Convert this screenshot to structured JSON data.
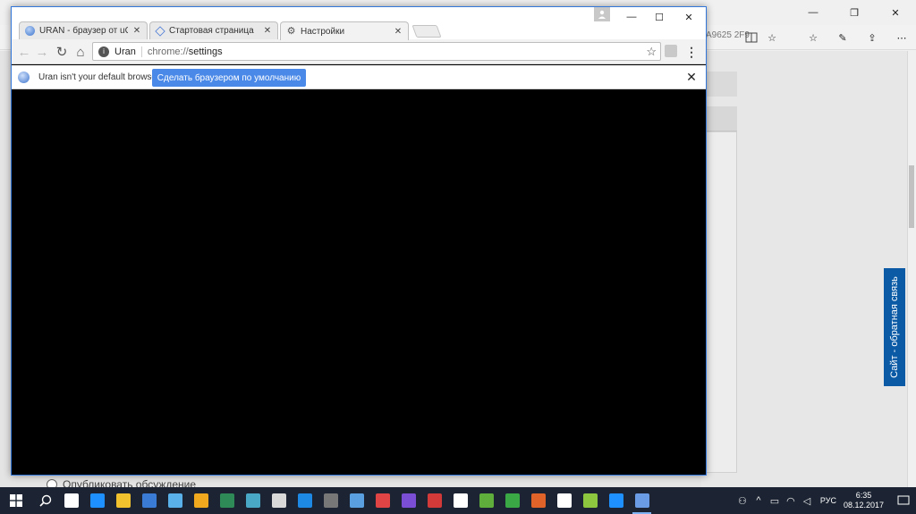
{
  "edge": {
    "url_tail": "A9625 2F9",
    "feedback_label": "Сайт - обратная связь",
    "comment_label": "Опубликовать обсуждение"
  },
  "uran": {
    "tabs": [
      {
        "title": "URAN - браузер от uCoz",
        "favicon": "globe-icon"
      },
      {
        "title": "Стартовая страница",
        "favicon": "diamond-icon"
      },
      {
        "title": "Настройки",
        "favicon": "gear-icon"
      }
    ],
    "omnibox": {
      "site_name": "Uran",
      "url_scheme": "chrome://",
      "url_path": "settings"
    },
    "infobar": {
      "message": "Uran isn't your default browser.",
      "button_label": "Сделать браузером по умолчанию"
    }
  },
  "taskbar": {
    "apps": [
      {
        "name": "task-view",
        "color": "#ffffff",
        "running": false
      },
      {
        "name": "edge",
        "color": "#1e90ff",
        "running": false
      },
      {
        "name": "explorer",
        "color": "#f2c12e",
        "running": false
      },
      {
        "name": "store",
        "color": "#3a7bd5",
        "running": false
      },
      {
        "name": "mail",
        "color": "#5ab0e8",
        "running": false
      },
      {
        "name": "photos",
        "color": "#f0a81e",
        "running": false
      },
      {
        "name": "app-green",
        "color": "#2e8b57",
        "running": false
      },
      {
        "name": "app-teal",
        "color": "#4aa8c7",
        "running": false
      },
      {
        "name": "calculator",
        "color": "#d9d9d9",
        "running": false
      },
      {
        "name": "app-blue",
        "color": "#1e88e5",
        "running": false
      },
      {
        "name": "app-gray",
        "color": "#777777",
        "running": false
      },
      {
        "name": "app-dots",
        "color": "#5aa0e0",
        "running": false
      },
      {
        "name": "app-paint",
        "color": "#e04444",
        "running": false
      },
      {
        "name": "visual-studio",
        "color": "#7b4ed6",
        "running": false
      },
      {
        "name": "app-red",
        "color": "#d23a3a",
        "running": false
      },
      {
        "name": "settings",
        "color": "#ffffff",
        "running": false
      },
      {
        "name": "utorrent",
        "color": "#5fae3b",
        "running": false
      },
      {
        "name": "app-f",
        "color": "#3aa845",
        "running": false
      },
      {
        "name": "app-orange",
        "color": "#e0642a",
        "running": false
      },
      {
        "name": "camera",
        "color": "#ffffff",
        "running": false
      },
      {
        "name": "app-plus",
        "color": "#8dc63f",
        "running": false
      },
      {
        "name": "edge-2",
        "color": "#1e90ff",
        "running": false
      },
      {
        "name": "uran",
        "color": "#6a9ce6",
        "running": true
      }
    ],
    "language": "РУС",
    "time": "6:35",
    "date": "08.12.2017"
  }
}
